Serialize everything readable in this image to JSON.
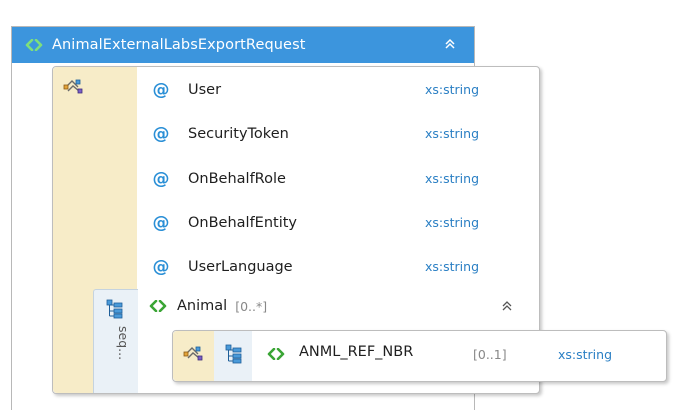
{
  "root": {
    "title": "AnimalExternalLabsExportRequest",
    "icon": "element-icon",
    "collapse_icon": "double-chevron-up-icon"
  },
  "attributes": [
    {
      "name": "User",
      "type": "xs:string"
    },
    {
      "name": "SecurityToken",
      "type": "xs:string"
    },
    {
      "name": "OnBehalfRole",
      "type": "xs:string"
    },
    {
      "name": "OnBehalfEntity",
      "type": "xs:string"
    },
    {
      "name": "UserLanguage",
      "type": "xs:string"
    }
  ],
  "sequence": {
    "label": "seq..."
  },
  "child_element": {
    "name": "Animal",
    "occurs": "[0..*]",
    "child": {
      "name": "ANML_REF_NBR",
      "occurs": "[0..1]",
      "type": "xs:string"
    }
  },
  "colors": {
    "title_bar": "#3c95dd",
    "model_group_bg": "#f7ecc8",
    "sequence_bg": "#eaf1f7",
    "element_icon": "#3aa535",
    "attribute_icon": "#2a8fd6",
    "type_text": "#2a7fc4"
  }
}
